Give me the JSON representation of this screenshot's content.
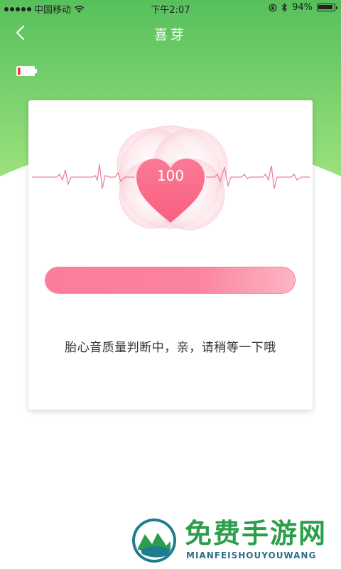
{
  "status_bar": {
    "carrier": "中国移动",
    "time": "下午2:07",
    "battery_percent": "94%",
    "battery_level": 0.94
  },
  "nav": {
    "title": "喜芽"
  },
  "monitor": {
    "bpm": "100",
    "quality_progress": 1.0,
    "message": "胎心音质量判断中，亲，请稍等一下哦"
  },
  "watermark": {
    "title": "免费手游网",
    "subtitle": "MIANFEISHOUYOUWANG"
  },
  "colors": {
    "header_green_top": "#56c05c",
    "header_green_bottom": "#9be17d",
    "heart_pink": "#fb6d8b",
    "progress_pink": "#fb7d99"
  }
}
